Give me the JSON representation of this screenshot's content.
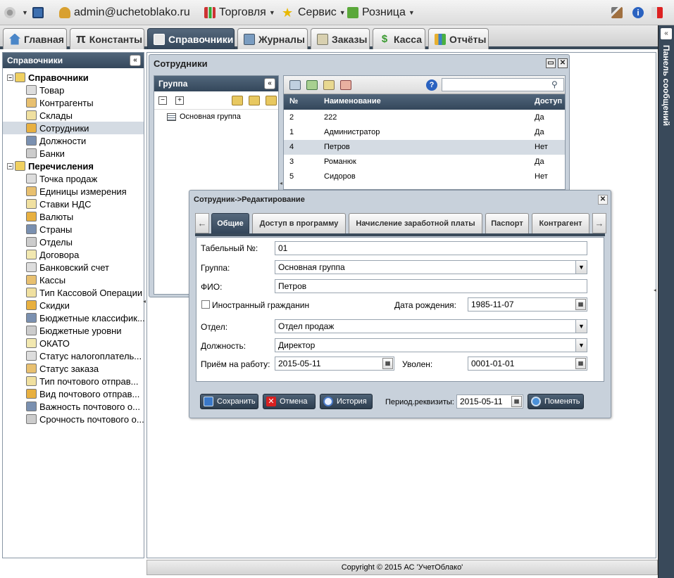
{
  "topbar": {
    "user": "admin@uchetoblako.ru",
    "menus": [
      "Торговля",
      "Сервис",
      "Розница"
    ]
  },
  "tabs": [
    "Главная",
    "Константы",
    "Справочники",
    "Журналы",
    "Заказы",
    "Касса",
    "Отчёты"
  ],
  "active_tab": "Справочники",
  "message_panel": "Панель сообщений",
  "tree": {
    "title": "Справочники",
    "items": [
      {
        "label": "Справочники",
        "level": 0,
        "bold": true
      },
      {
        "label": "Товар",
        "level": 1
      },
      {
        "label": "Контрагенты",
        "level": 1
      },
      {
        "label": "Склады",
        "level": 1
      },
      {
        "label": "Сотрудники",
        "level": 1,
        "selected": true
      },
      {
        "label": "Должности",
        "level": 1
      },
      {
        "label": "Банки",
        "level": 1
      },
      {
        "label": "Перечисления",
        "level": 0,
        "bold": true
      },
      {
        "label": "Точка продаж",
        "level": 1
      },
      {
        "label": "Единицы измерения",
        "level": 1
      },
      {
        "label": "Ставки НДС",
        "level": 1
      },
      {
        "label": "Валюты",
        "level": 1
      },
      {
        "label": "Страны",
        "level": 1
      },
      {
        "label": "Отделы",
        "level": 1
      },
      {
        "label": "Договора",
        "level": 1
      },
      {
        "label": "Банковский счет",
        "level": 1
      },
      {
        "label": "Кассы",
        "level": 1
      },
      {
        "label": "Тип Кассовой Операции",
        "level": 1
      },
      {
        "label": "Скидки",
        "level": 1
      },
      {
        "label": "Бюджетные классифик...",
        "level": 1
      },
      {
        "label": "Бюджетные уровни",
        "level": 1
      },
      {
        "label": "ОКАТО",
        "level": 1
      },
      {
        "label": "Статус налогоплатель...",
        "level": 1
      },
      {
        "label": "Статус заказа",
        "level": 1
      },
      {
        "label": "Тип почтового отправ...",
        "level": 1
      },
      {
        "label": "Вид почтового отправ...",
        "level": 1
      },
      {
        "label": "Важность почтового о...",
        "level": 1
      },
      {
        "label": "Срочность почтового о...",
        "level": 1
      }
    ]
  },
  "employees_window": {
    "title": "Сотрудники",
    "group_panel": {
      "title": "Группа",
      "items": [
        "Основная группа"
      ]
    },
    "grid": {
      "search_placeholder": "",
      "columns": [
        "№",
        "Наименование",
        "Доступ"
      ],
      "rows": [
        {
          "num": "2",
          "name": "222",
          "access": "Да"
        },
        {
          "num": "1",
          "name": "Администратор",
          "access": "Да"
        },
        {
          "num": "4",
          "name": "Петров",
          "access": "Нет",
          "selected": true
        },
        {
          "num": "3",
          "name": "Романюк",
          "access": "Да"
        },
        {
          "num": "5",
          "name": "Сидоров",
          "access": "Нет"
        }
      ]
    }
  },
  "dialog": {
    "title": "Сотрудник->Редактирование",
    "tabs": [
      "Общие",
      "Доступ в программу",
      "Начисление заработной платы",
      "Паспорт",
      "Контрагент"
    ],
    "fields": {
      "tab_num_label": "Табельный №:",
      "tab_num": "01",
      "group_label": "Группа:",
      "group": "Основная группа",
      "fio_label": "ФИО:",
      "fio": "Петров",
      "foreign_label": "Иностранный гражданин",
      "birth_label": "Дата рождения:",
      "birth": "1985-11-07",
      "dept_label": "Отдел:",
      "dept": "Отдел продаж",
      "position_label": "Должность:",
      "position": "Директор",
      "hire_label": "Приём на работу:",
      "hire": "2015-05-11",
      "fired_label": "Уволен:",
      "fired": "0001-01-01"
    },
    "buttons": {
      "save": "Сохранить",
      "cancel": "Отмена",
      "history": "История",
      "period_label": "Период.реквизиты:",
      "period": "2015-05-11",
      "change": "Поменять"
    }
  },
  "footer": "Copyright © 2015 АС 'УчетОблако'"
}
